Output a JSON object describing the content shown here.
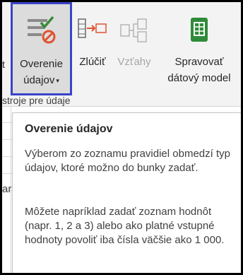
{
  "ribbon": {
    "left_partial": {
      "line1": "t",
      "group_partial": "stroje pre údaje"
    },
    "buttons": [
      {
        "line1": "Overenie",
        "line2": "údajov",
        "has_dropdown": true,
        "icon": "data-validation-icon",
        "selected": true
      },
      {
        "line1": "Zlúčiť",
        "line2": "",
        "has_dropdown": false,
        "icon": "consolidate-icon",
        "selected": false
      },
      {
        "line1": "Vzťahy",
        "line2": "",
        "has_dropdown": false,
        "icon": "relationships-icon",
        "disabled": true
      },
      {
        "line1": "Spravovať",
        "line2": "dátový model",
        "has_dropdown": false,
        "icon": "data-model-icon",
        "selected": false
      }
    ],
    "dropdown_glyph": "▾"
  },
  "sheet": {
    "row_fragment": "ar"
  },
  "tooltip": {
    "title": "Overenie údajov",
    "para1": "Výberom zo zoznamu pravidiel obmedzí typ údajov, ktoré možno do bunky zadať.",
    "para2": "Môžete napríklad zadať zoznam hodnôt (napr. 1, 2 a 3) alebo ako platné vstupné hodnoty povoliť iba čísla väčšie ako 1 000."
  },
  "colors": {
    "selection_border": "#3a44c9",
    "validation_check": "#3a8a3a",
    "validation_stop": "#e0522f",
    "model_green": "#2e8b3a"
  }
}
